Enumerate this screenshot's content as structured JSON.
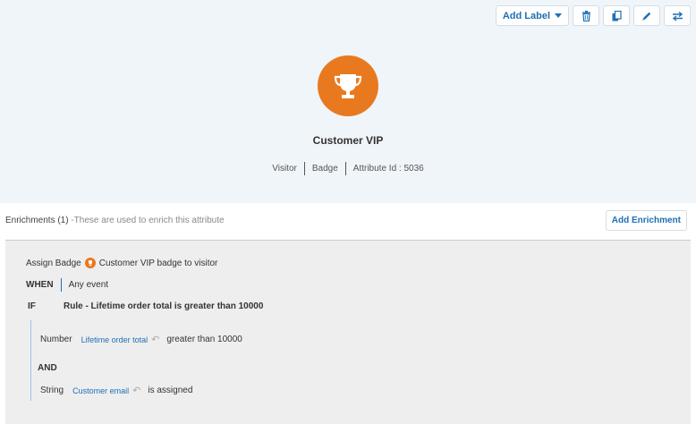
{
  "toolbar": {
    "add_label": "Add Label",
    "icons": [
      "trash-icon",
      "copy-icon",
      "pencil-icon",
      "swap-icon"
    ]
  },
  "attribute": {
    "name": "Customer VIP",
    "type": "Visitor",
    "kind": "Badge",
    "id_text": "Attribute Id : 5036",
    "badge_color": "#e8791f",
    "badge_icon": "trophy-icon"
  },
  "enrichments": {
    "title": "Enrichments (1)",
    "subtitle": " -These are used to enrich this attribute",
    "add_button": "Add Enrichment",
    "rule": {
      "assign_prefix": "Assign Badge",
      "assign_text": "Customer VIP badge to visitor",
      "when_label": "WHEN",
      "when_value": "Any event",
      "if_label": "IF",
      "if_value": "Rule - Lifetime order total is greater than 10000",
      "and_label": "AND",
      "conditions": [
        {
          "type": "Number",
          "field": "Lifetime order total",
          "op": "greater than 10000"
        },
        {
          "type": "String",
          "field": "Customer email",
          "op": "is assigned"
        }
      ]
    }
  },
  "colors": {
    "accent": "#1f6fb5",
    "header_bg": "#f0f5fa",
    "rule_bg": "#eeeeee"
  }
}
